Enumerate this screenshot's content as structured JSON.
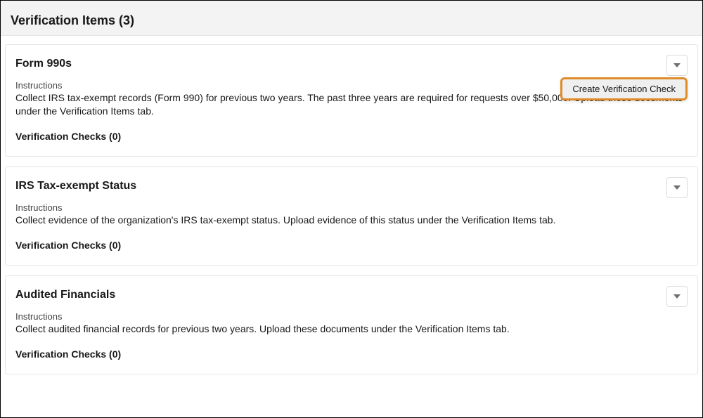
{
  "panel": {
    "title": "Verification Items (3)"
  },
  "items": [
    {
      "title": "Form 990s",
      "instructionsLabel": "Instructions",
      "instructions": "Collect IRS tax-exempt records (Form 990) for previous two years. The past three years are required for requests over $50,000. Upload these documents under the Verification Items tab.",
      "checksLabel": "Verification Checks (0)",
      "showDropdown": true,
      "dropdownItem": "Create Verification Check"
    },
    {
      "title": "IRS Tax-exempt Status",
      "instructionsLabel": "Instructions",
      "instructions": "Collect evidence of the organization's IRS tax-exempt status. Upload evidence of this status under the Verification Items tab.",
      "checksLabel": "Verification Checks (0)"
    },
    {
      "title": "Audited Financials",
      "instructionsLabel": "Instructions",
      "instructions": "Collect audited financial records for previous two years. Upload these documents under the Verification Items tab.",
      "checksLabel": "Verification Checks (0)"
    }
  ]
}
